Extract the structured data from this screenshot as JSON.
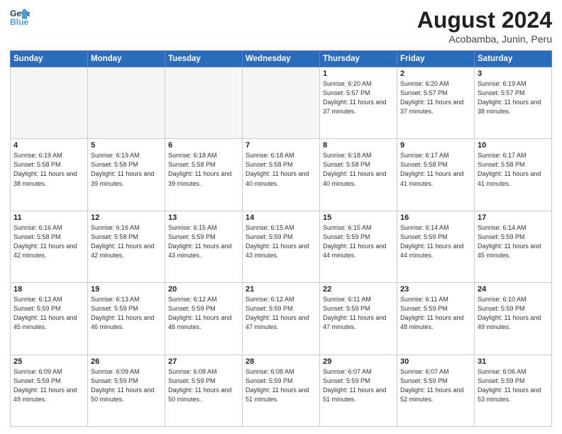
{
  "header": {
    "logo_line1": "General",
    "logo_line2": "Blue",
    "month_year": "August 2024",
    "location": "Acobamba, Junin, Peru"
  },
  "weekdays": [
    "Sunday",
    "Monday",
    "Tuesday",
    "Wednesday",
    "Thursday",
    "Friday",
    "Saturday"
  ],
  "weeks": [
    [
      {
        "day": "",
        "empty": true
      },
      {
        "day": "",
        "empty": true
      },
      {
        "day": "",
        "empty": true
      },
      {
        "day": "",
        "empty": true
      },
      {
        "day": "1",
        "sunrise": "6:20 AM",
        "sunset": "5:57 PM",
        "daylight": "11 hours and 37 minutes."
      },
      {
        "day": "2",
        "sunrise": "6:20 AM",
        "sunset": "5:57 PM",
        "daylight": "11 hours and 37 minutes."
      },
      {
        "day": "3",
        "sunrise": "6:19 AM",
        "sunset": "5:57 PM",
        "daylight": "11 hours and 38 minutes."
      }
    ],
    [
      {
        "day": "4",
        "sunrise": "6:19 AM",
        "sunset": "5:58 PM",
        "daylight": "11 hours and 38 minutes."
      },
      {
        "day": "5",
        "sunrise": "6:19 AM",
        "sunset": "5:58 PM",
        "daylight": "11 hours and 39 minutes."
      },
      {
        "day": "6",
        "sunrise": "6:18 AM",
        "sunset": "5:58 PM",
        "daylight": "11 hours and 39 minutes."
      },
      {
        "day": "7",
        "sunrise": "6:18 AM",
        "sunset": "5:58 PM",
        "daylight": "11 hours and 40 minutes."
      },
      {
        "day": "8",
        "sunrise": "6:18 AM",
        "sunset": "5:58 PM",
        "daylight": "11 hours and 40 minutes."
      },
      {
        "day": "9",
        "sunrise": "6:17 AM",
        "sunset": "5:58 PM",
        "daylight": "11 hours and 41 minutes."
      },
      {
        "day": "10",
        "sunrise": "6:17 AM",
        "sunset": "5:58 PM",
        "daylight": "11 hours and 41 minutes."
      }
    ],
    [
      {
        "day": "11",
        "sunrise": "6:16 AM",
        "sunset": "5:58 PM",
        "daylight": "11 hours and 42 minutes."
      },
      {
        "day": "12",
        "sunrise": "6:16 AM",
        "sunset": "5:58 PM",
        "daylight": "11 hours and 42 minutes."
      },
      {
        "day": "13",
        "sunrise": "6:15 AM",
        "sunset": "5:59 PM",
        "daylight": "11 hours and 43 minutes."
      },
      {
        "day": "14",
        "sunrise": "6:15 AM",
        "sunset": "5:59 PM",
        "daylight": "11 hours and 43 minutes."
      },
      {
        "day": "15",
        "sunrise": "6:15 AM",
        "sunset": "5:59 PM",
        "daylight": "11 hours and 44 minutes."
      },
      {
        "day": "16",
        "sunrise": "6:14 AM",
        "sunset": "5:59 PM",
        "daylight": "11 hours and 44 minutes."
      },
      {
        "day": "17",
        "sunrise": "6:14 AM",
        "sunset": "5:59 PM",
        "daylight": "11 hours and 45 minutes."
      }
    ],
    [
      {
        "day": "18",
        "sunrise": "6:13 AM",
        "sunset": "5:59 PM",
        "daylight": "11 hours and 45 minutes."
      },
      {
        "day": "19",
        "sunrise": "6:13 AM",
        "sunset": "5:59 PM",
        "daylight": "11 hours and 46 minutes."
      },
      {
        "day": "20",
        "sunrise": "6:12 AM",
        "sunset": "5:59 PM",
        "daylight": "11 hours and 46 minutes."
      },
      {
        "day": "21",
        "sunrise": "6:12 AM",
        "sunset": "5:59 PM",
        "daylight": "11 hours and 47 minutes."
      },
      {
        "day": "22",
        "sunrise": "6:11 AM",
        "sunset": "5:59 PM",
        "daylight": "11 hours and 47 minutes."
      },
      {
        "day": "23",
        "sunrise": "6:11 AM",
        "sunset": "5:59 PM",
        "daylight": "11 hours and 48 minutes."
      },
      {
        "day": "24",
        "sunrise": "6:10 AM",
        "sunset": "5:59 PM",
        "daylight": "11 hours and 49 minutes."
      }
    ],
    [
      {
        "day": "25",
        "sunrise": "6:09 AM",
        "sunset": "5:59 PM",
        "daylight": "11 hours and 49 minutes."
      },
      {
        "day": "26",
        "sunrise": "6:09 AM",
        "sunset": "5:59 PM",
        "daylight": "11 hours and 50 minutes."
      },
      {
        "day": "27",
        "sunrise": "6:08 AM",
        "sunset": "5:59 PM",
        "daylight": "11 hours and 50 minutes."
      },
      {
        "day": "28",
        "sunrise": "6:08 AM",
        "sunset": "5:59 PM",
        "daylight": "11 hours and 51 minutes."
      },
      {
        "day": "29",
        "sunrise": "6:07 AM",
        "sunset": "5:59 PM",
        "daylight": "11 hours and 51 minutes."
      },
      {
        "day": "30",
        "sunrise": "6:07 AM",
        "sunset": "5:59 PM",
        "daylight": "11 hours and 52 minutes."
      },
      {
        "day": "31",
        "sunrise": "6:06 AM",
        "sunset": "5:59 PM",
        "daylight": "11 hours and 53 minutes."
      }
    ]
  ]
}
